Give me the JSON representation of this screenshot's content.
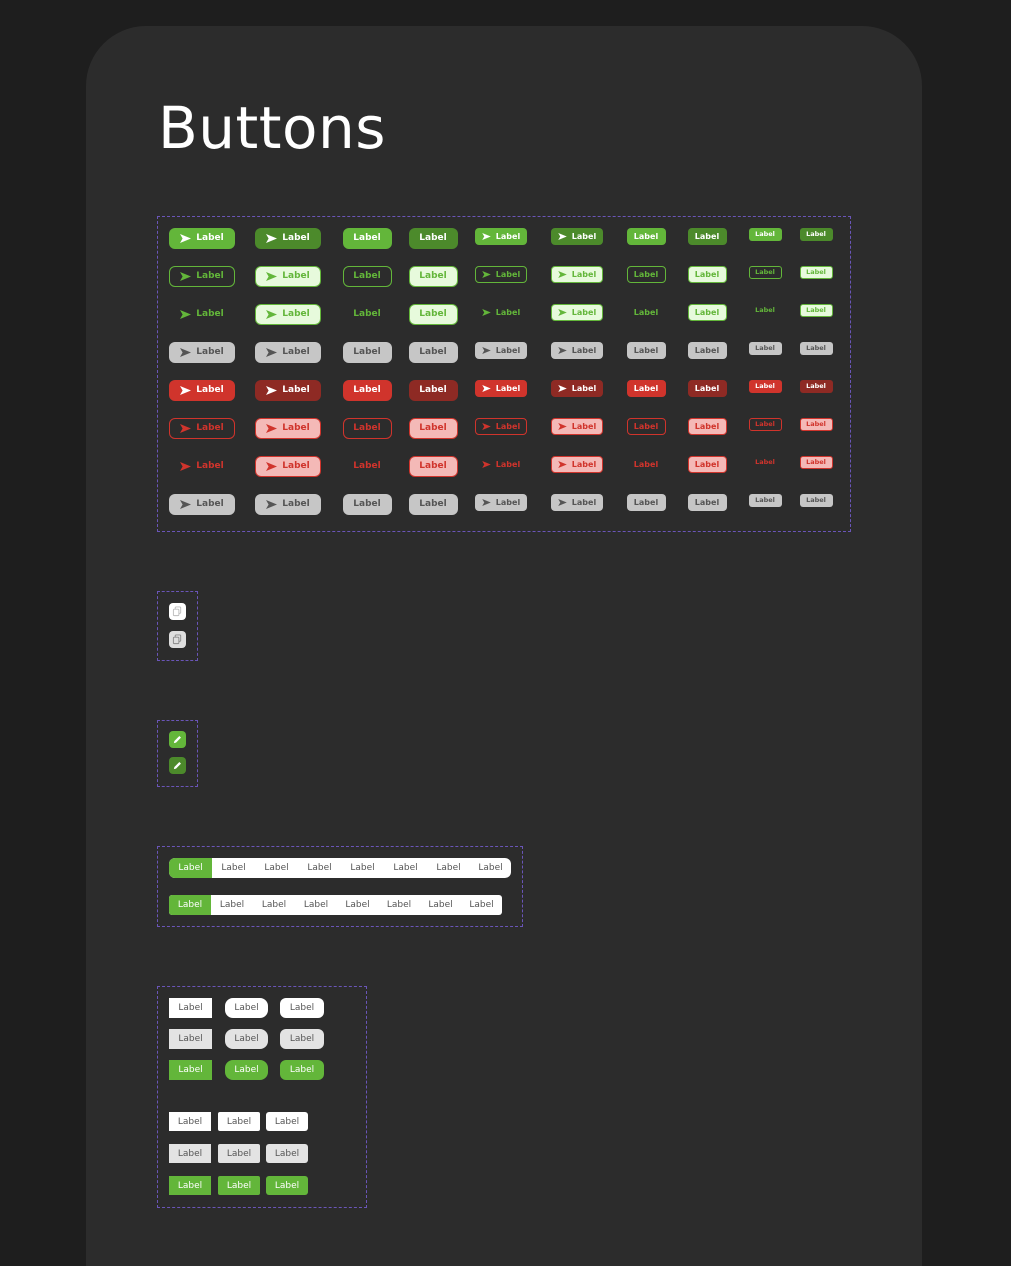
{
  "page": {
    "title": "Buttons"
  },
  "colors": {
    "background": "#1e1e1e",
    "card": "#2c2c2c",
    "frame_border": "#6a55b8",
    "green": "#63b63a",
    "dark_green": "#4c8a2b",
    "light_green": "#e7fadc",
    "red": "#d0342c",
    "dark_red": "#8e2a24",
    "light_red": "#f4b9b7",
    "grey": "#c6c6c6"
  },
  "button_label": "Label",
  "button_grid": {
    "icon": "send-arrow-icon",
    "rows": [
      "green-filled",
      "green-outline",
      "green-text",
      "grey-disabled",
      "red-filled",
      "red-outline",
      "red-text",
      "grey-disabled"
    ]
  },
  "icon_buttons": {
    "icon": "copy-icon",
    "count": 2
  },
  "edit_buttons": {
    "icon": "pencil-icon",
    "count": 2
  },
  "segmented_controls": [
    {
      "items": [
        "Label",
        "Label",
        "Label",
        "Label",
        "Label",
        "Label",
        "Label",
        "Label"
      ],
      "active_index": 0
    },
    {
      "items": [
        "Label",
        "Label",
        "Label",
        "Label",
        "Label",
        "Label",
        "Label",
        "Label"
      ],
      "active_index": 0
    }
  ],
  "plain_buttons": {
    "rows": [
      "white",
      "grey",
      "green",
      "white",
      "grey",
      "green"
    ],
    "label": "Label"
  }
}
